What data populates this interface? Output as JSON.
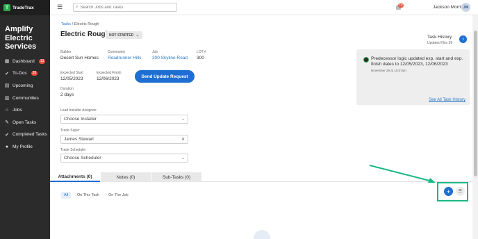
{
  "brand": {
    "name": "TradeTrax",
    "logo_letter": "T"
  },
  "company": {
    "name": "Amplify Electric Services"
  },
  "sidebar": {
    "items": [
      {
        "label": "Dashboard",
        "icon": "grid-icon",
        "badge": "13"
      },
      {
        "label": "To-Dos",
        "icon": "check-circle-icon",
        "badge": "35"
      },
      {
        "label": "Upcoming",
        "icon": "calendar-icon",
        "badge": ""
      },
      {
        "label": "Communities",
        "icon": "map-icon",
        "badge": ""
      },
      {
        "label": "Jobs",
        "icon": "home-icon",
        "badge": ""
      },
      {
        "label": "Open Tasks",
        "icon": "wrench-icon",
        "badge": ""
      },
      {
        "label": "Completed Tasks",
        "icon": "check-circle-icon",
        "badge": ""
      },
      {
        "label": "My Profile",
        "icon": "user-icon",
        "badge": ""
      }
    ]
  },
  "topbar": {
    "search_placeholder": "Search Jobs and Tasks",
    "user_name": "Jackson Morris",
    "avatar_initials": "JM",
    "notification_count": "10"
  },
  "breadcrumb": {
    "parent": "Tasks",
    "current": "Electric Rough"
  },
  "task": {
    "title": "Electric Rough",
    "status": "NOT STARTED",
    "builder_label": "Builder",
    "builder": "Desert Sun Homes",
    "community_label": "Community",
    "community": "Roadrunner Hills",
    "job_label": "Job",
    "job": "300 Skyline Road",
    "lot_label": "LOT #",
    "lot": "300",
    "expected_start_label": "Expected Start",
    "expected_start": "12/05/2023",
    "expected_finish_label": "Expected Finish",
    "expected_finish": "12/06/2023",
    "duration_label": "Duration",
    "duration": "2 days",
    "update_button": "Send Update Request"
  },
  "assignees": {
    "lead_installer_label": "Lead Installer Assignee",
    "lead_installer_placeholder": "Choose Installer",
    "trade_super_label": "Trade Super",
    "trade_super_value": "James Stewart",
    "trade_scheduler_label": "Trade Scheduler",
    "trade_scheduler_placeholder": "Choose Scheduler"
  },
  "tabs": [
    {
      "label": "Attachments (0)",
      "active": true
    },
    {
      "label": "Notes (0)",
      "active": false
    },
    {
      "label": "Sub-Tasks (0)",
      "active": false
    }
  ],
  "filters": [
    {
      "label": "All",
      "active": true
    },
    {
      "label": "On This Task",
      "active": false
    },
    {
      "label": "On The Job",
      "active": false
    }
  ],
  "history": {
    "title": "Task History",
    "updated": "Updated Nov 29",
    "entry_text": "Predecessor logic updated exp. start and exp. finish dates to 12/05/2023, 12/06/2023",
    "entry_time": "November 29 at 10:57am",
    "see_all": "See All Task History"
  },
  "colors": {
    "accent": "#1e6fd1",
    "sidebar_bg": "#2b2b2b",
    "annotation": "#19b885",
    "badge": "#e2513b"
  }
}
